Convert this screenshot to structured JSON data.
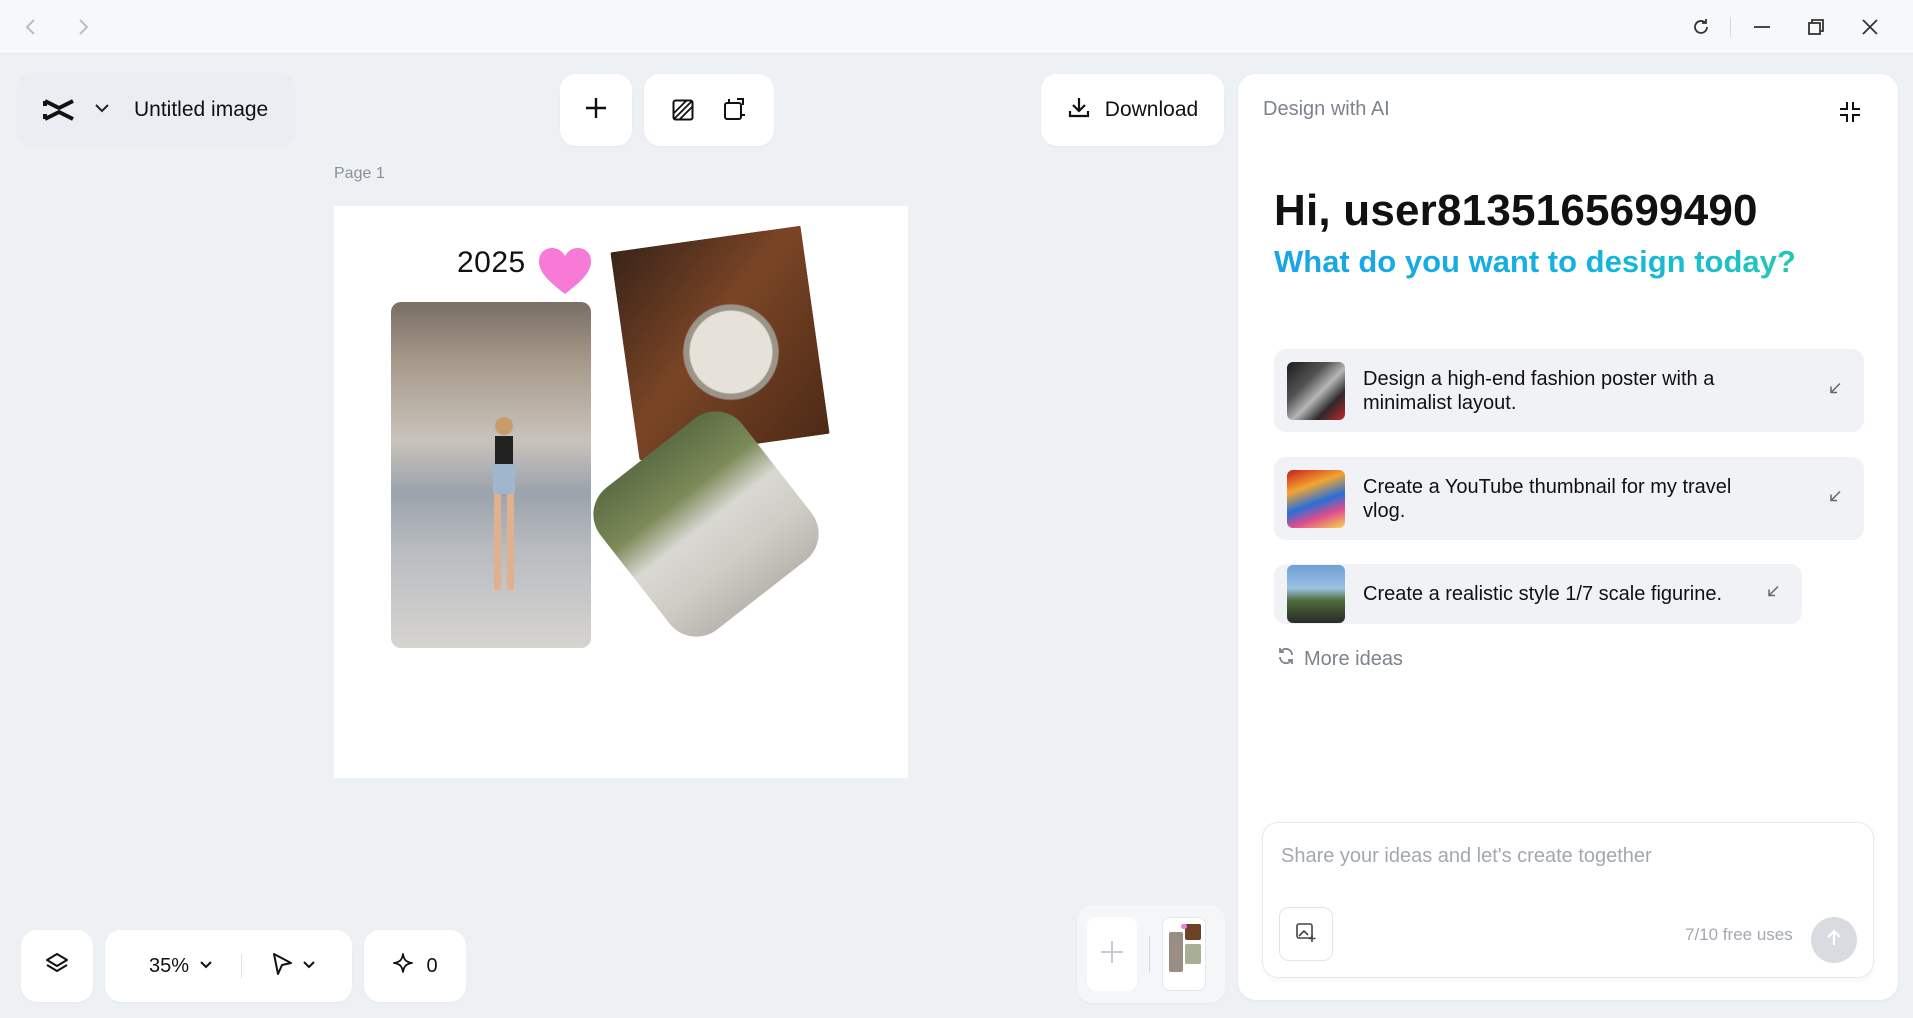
{
  "window": {
    "nav": {
      "back_icon": "chevron-left-icon",
      "forward_icon": "chevron-right-icon"
    },
    "controls": [
      "refresh-icon",
      "minimize-icon",
      "restore-icon",
      "close-icon"
    ]
  },
  "header": {
    "file_title": "Untitled image",
    "download_label": "Download"
  },
  "toolbar": {
    "add_icon": "plus-icon",
    "background_icon": "background-pattern-icon",
    "resize_icon": "resize-icon"
  },
  "canvas": {
    "page_label": "Page 1",
    "year_text": "2025"
  },
  "bottom_toolbar": {
    "zoom": "35%",
    "ai_credits": "0"
  },
  "ai_panel": {
    "title": "Design with AI",
    "greeting": "Hi, user8135165699490",
    "subtitle": "What do you want to design today?",
    "suggestions": [
      {
        "text": "Design a high-end fashion poster with a minimalist layout."
      },
      {
        "text": "Create a YouTube thumbnail for my travel vlog."
      },
      {
        "text": "Create a realistic style 1/7 scale figurine."
      }
    ],
    "more_ideas": "More ideas",
    "composer": {
      "placeholder": "Share your ideas and let's create together",
      "value": "",
      "free_uses": "7/10 free uses"
    }
  },
  "colors": {
    "accent_gradient_start": "#1aa4e8",
    "accent_gradient_end": "#24c7b7",
    "heart": "#f67ad6",
    "workspace_bg": "#eef1f4"
  }
}
